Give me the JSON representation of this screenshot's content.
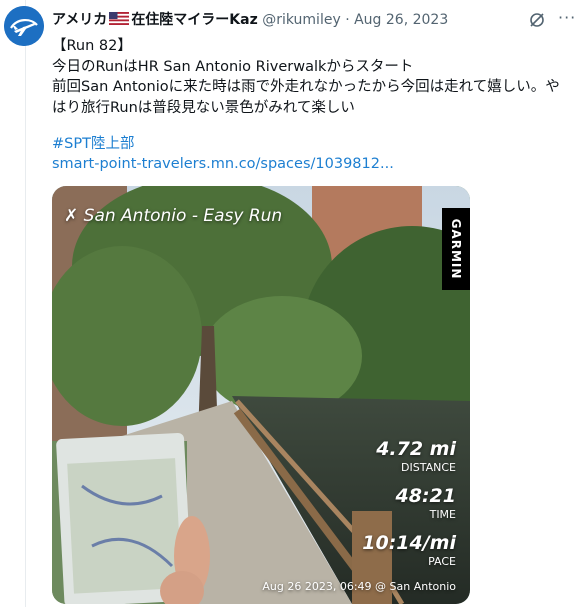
{
  "tweet": {
    "display_name": "アメリカ",
    "display_name_2": "在住陸マイラーKaz",
    "handle": "@rikumiley",
    "separator": "·",
    "date": "Aug 26, 2023",
    "more": "···",
    "line1": "【Run 82】",
    "line2": "今日のRunはHR San Antonio Riverwalkからスタート",
    "line3": "前回San Antonioに来た時は雨で外走れなかったから今回は走れて嬉しい。やはり旅行Runは普段見ない景色がみれて楽しい",
    "hashtag": "#SPT陸上部",
    "link": "smart-point-travelers.mn.co/spaces/1039812..."
  },
  "photo": {
    "title": "San Antonio - Easy Run",
    "brand": "GARMIN",
    "stats": [
      {
        "value": "4.72 mi",
        "label": "DISTANCE"
      },
      {
        "value": "48:21",
        "label": "TIME"
      },
      {
        "value": "10:14/mi",
        "label": "PACE"
      }
    ],
    "caption": "Aug 26 2023, 06:49 @ San Antonio"
  },
  "colors": {
    "link": "#1d7fd1",
    "muted": "#536471",
    "avatar": "#1d6fc2"
  }
}
